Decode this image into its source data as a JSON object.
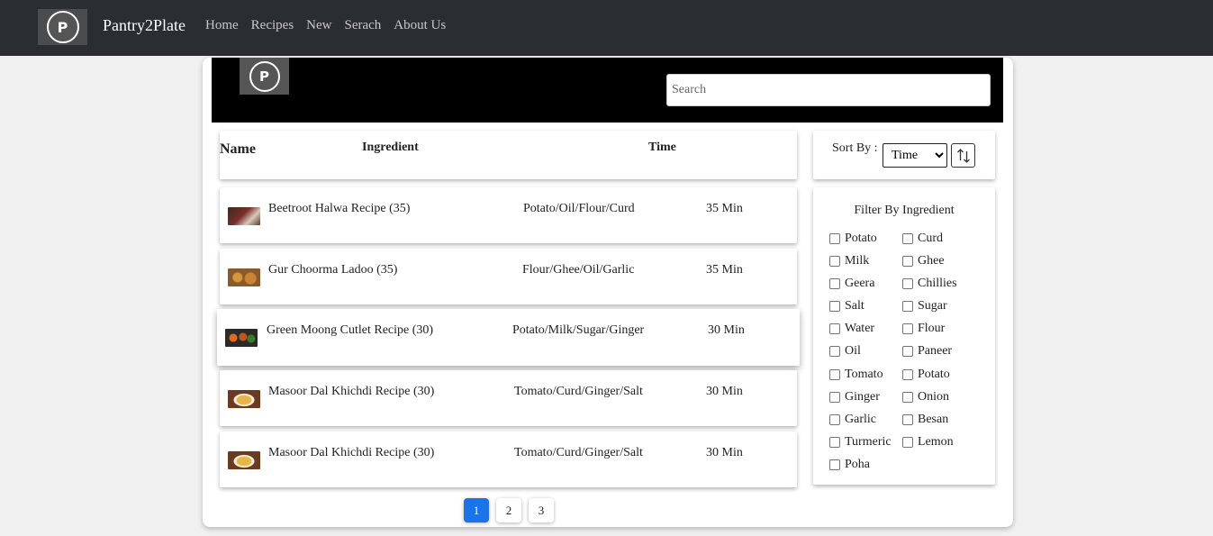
{
  "nav": {
    "brand": "Pantry2Plate",
    "links": [
      "Home",
      "Recipes",
      "New",
      "Serach",
      "About Us"
    ]
  },
  "search": {
    "placeholder": "Search"
  },
  "table": {
    "headers": {
      "name": "Name",
      "ingredient": "Ingredient",
      "time": "Time"
    },
    "rows": [
      {
        "name": "Beetroot Halwa Recipe (35)",
        "ingredients": "Potato/Oil/Flour/Curd",
        "time": "35 Min",
        "thumb": "#7a2e2a"
      },
      {
        "name": "Gur Choorma Ladoo (35)",
        "ingredients": "Flour/Ghee/Oil/Garlic",
        "time": "35 Min",
        "thumb": "#b7792f"
      },
      {
        "name": "Green Moong Cutlet Recipe (30)",
        "ingredients": "Potato/Milk/Sugar/Ginger",
        "time": "30 Min",
        "thumb": "#c2541f"
      },
      {
        "name": "Masoor Dal Khichdi Recipe (30)",
        "ingredients": "Tomato/Curd/Ginger/Salt",
        "time": "30 Min",
        "thumb": "#d7a13a"
      },
      {
        "name": "Masoor Dal Khichdi Recipe (30)",
        "ingredients": "Tomato/Curd/Ginger/Salt",
        "time": "30 Min",
        "thumb": "#d7a13a"
      }
    ]
  },
  "sort": {
    "label": "Sort By :",
    "selected": "Time",
    "options": [
      "Time"
    ]
  },
  "filter": {
    "title": "Filter By Ingredient",
    "left": [
      "Potato",
      "Milk",
      "Geera",
      "Salt",
      "Water",
      "Oil",
      "Tomato",
      "Ginger",
      "Garlic",
      "Turmeric",
      "Poha"
    ],
    "right": [
      "Curd",
      "Ghee",
      "Chillies",
      "Sugar",
      "Flour",
      "Paneer",
      "Potato",
      "Onion",
      "Besan",
      "Lemon"
    ]
  },
  "pagination": {
    "pages": [
      "1",
      "2",
      "3"
    ],
    "active": "1"
  },
  "colors": {
    "navbar": "#2b2e31",
    "hero": "#000000",
    "active_page": "#1a73e8"
  }
}
